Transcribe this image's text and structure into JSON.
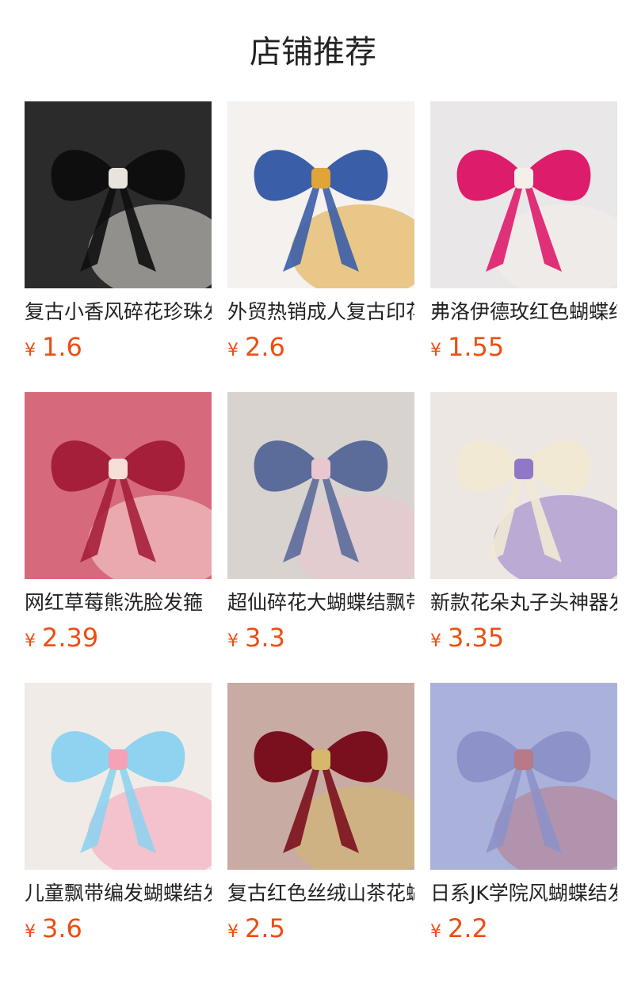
{
  "header": {
    "title": "店铺推荐"
  },
  "currency": "¥",
  "products": [
    {
      "name": "复古小香风碎花珍珠发夹",
      "price": "1.6",
      "colors": {
        "bg": "#2b2b2b",
        "a": "#0e0e0e",
        "b": "#e8e4dc"
      }
    },
    {
      "name": "外贸热销成人复古印花",
      "price": "2.6",
      "colors": {
        "bg": "#f4f1ee",
        "a": "#3b5ea8",
        "b": "#e0a437"
      }
    },
    {
      "name": "弗洛伊德玫红色蝴蝶结",
      "price": "1.55",
      "colors": {
        "bg": "#e9e7e8",
        "a": "#de1c6c",
        "b": "#f4efe9"
      }
    },
    {
      "name": "网红草莓熊洗脸发箍",
      "price": "2.39",
      "colors": {
        "bg": "#d7697c",
        "a": "#a51f3a",
        "b": "#f7dfd8"
      }
    },
    {
      "name": "超仙碎花大蝴蝶结飘带",
      "price": "3.3",
      "colors": {
        "bg": "#d9d3cf",
        "a": "#5b6b9a",
        "b": "#e9c7cf"
      }
    },
    {
      "name": "新款花朵丸子头神器发圈",
      "price": "3.35",
      "colors": {
        "bg": "#ede7e3",
        "a": "#f1e9d4",
        "b": "#8f78c8"
      }
    },
    {
      "name": "儿童飘带编发蝴蝶结发夹",
      "price": "3.6",
      "colors": {
        "bg": "#f0ebe6",
        "a": "#8fd3f0",
        "b": "#f5a1b6"
      }
    },
    {
      "name": "复古红色丝绒山茶花蝴蝶结",
      "price": "2.5",
      "colors": {
        "bg": "#c8aba3",
        "a": "#7a0f1e",
        "b": "#d6b86a"
      }
    },
    {
      "name": "日系JK学院风蝴蝶结发夹",
      "price": "2.2",
      "colors": {
        "bg": "#aab2dc",
        "a": "#8d92c8",
        "b": "#b77a86"
      }
    }
  ]
}
